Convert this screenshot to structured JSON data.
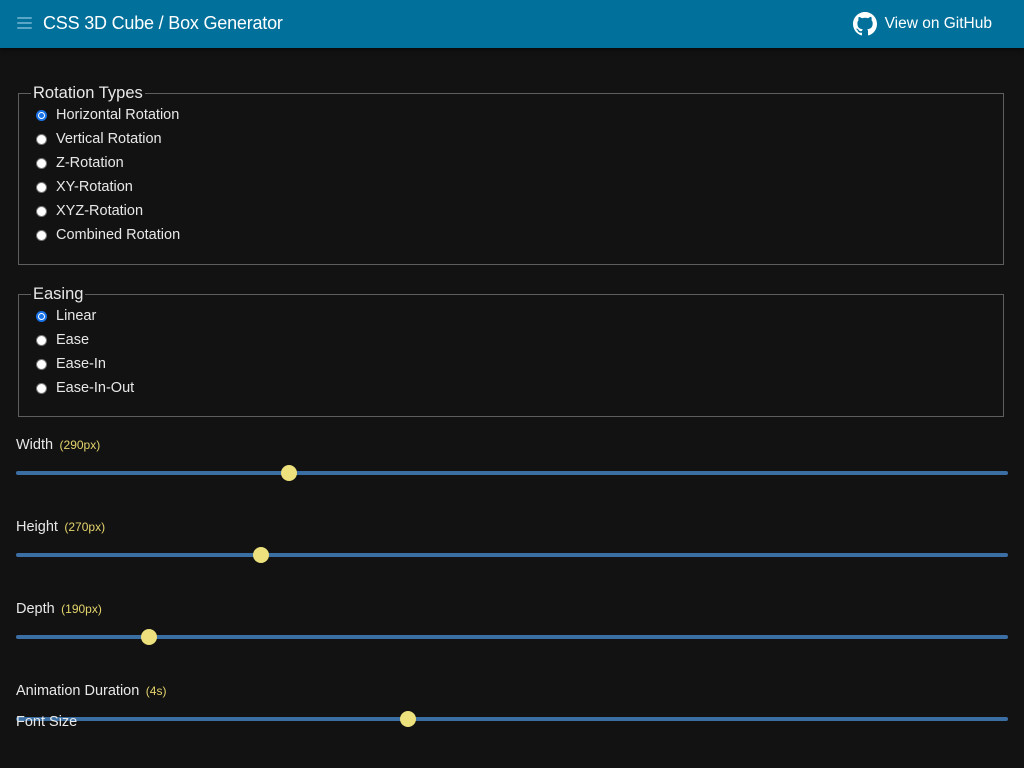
{
  "header": {
    "title": "CSS 3D Cube / Box Generator",
    "github_label": "View on GitHub",
    "menu_icon": "hamburger-icon",
    "github_icon": "github-icon",
    "bg_color": "#01709b"
  },
  "rotation": {
    "legend": "Rotation Types",
    "options": [
      {
        "label": "Horizontal Rotation",
        "checked": true
      },
      {
        "label": "Vertical Rotation",
        "checked": false
      },
      {
        "label": "Z-Rotation",
        "checked": false
      },
      {
        "label": "XY-Rotation",
        "checked": false
      },
      {
        "label": "XYZ-Rotation",
        "checked": false
      },
      {
        "label": "Combined Rotation",
        "checked": false
      }
    ]
  },
  "easing": {
    "legend": "Easing",
    "options": [
      {
        "label": "Linear",
        "checked": true
      },
      {
        "label": "Ease",
        "checked": false
      },
      {
        "label": "Ease-In",
        "checked": false
      },
      {
        "label": "Ease-In-Out",
        "checked": false
      }
    ]
  },
  "sliders": [
    {
      "label": "Width",
      "value_text": "(290px)",
      "fraction": 0.275
    },
    {
      "label": "Height",
      "value_text": "(270px)",
      "fraction": 0.247
    },
    {
      "label": "Depth",
      "value_text": "(190px)",
      "fraction": 0.134
    },
    {
      "label": "Animation Duration",
      "value_text": "(4s)",
      "fraction": 0.395
    }
  ],
  "partial_label": "Font Size",
  "colors": {
    "accent": "#01709b",
    "track": "#3b6fa4",
    "thumb": "#ece17c",
    "value_text": "#e3d46c",
    "background": "#121212"
  }
}
